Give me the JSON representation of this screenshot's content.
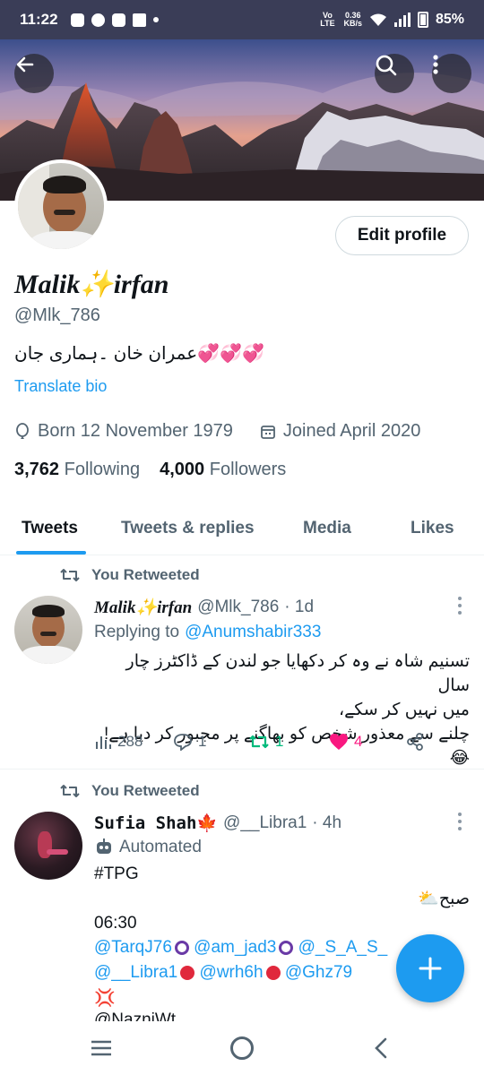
{
  "status_bar": {
    "time": "11:22",
    "network_label": "Vo LTE",
    "speed_value": "0.36",
    "speed_unit": "KB/s",
    "battery": "85%"
  },
  "profile": {
    "display_name": "Malik✨irfan",
    "handle": "@Mlk_786",
    "bio": "عمران خان ۔ہماری جان💞💞💞",
    "translate_label": "Translate bio",
    "born": "Born 12 November 1979",
    "joined": "Joined April 2020",
    "following_count": "3,762",
    "following_label": "Following",
    "followers_count": "4,000",
    "followers_label": "Followers",
    "edit_label": "Edit profile"
  },
  "tabs": [
    {
      "label": "Tweets",
      "active": true
    },
    {
      "label": "Tweets & replies",
      "active": false
    },
    {
      "label": "Media",
      "active": false
    },
    {
      "label": "Likes",
      "active": false
    }
  ],
  "tweets": [
    {
      "retweet_label": "You Retweeted",
      "author_name": "Malik✨irfan",
      "author_handle": "@Mlk_786",
      "time": "· 1d",
      "replying_prefix": "Replying to",
      "replying_to": "@Anumshabir333",
      "text_lines": [
        "تسنیم شاہ نے وہ کر دکھایا جو لندن کے ڈاکٹرز چار سال",
        "میں نہیں کر سکے،",
        "چلنے سے معذور شخص کو بھاگنے پر مجبور کر دیا ہے!😂"
      ],
      "views": "288",
      "replies": "1",
      "retweets": "1",
      "likes": "4"
    },
    {
      "retweet_label": "You Retweeted",
      "author_name": "Sufia Shah🍁",
      "author_handle": "@__Libra1",
      "time": "· 4h",
      "automated_label": "Automated",
      "hashtag": "#TPG",
      "greeting": "صبح⛅",
      "clock": "06:30",
      "mentions_line1": [
        "@TarqJ76",
        "@am_jad3",
        "@_S_A_S_"
      ],
      "mentions_line2": [
        "@__Libra1",
        "@wrh6h",
        "@Ghz79"
      ],
      "mentions_line3": "💢",
      "mentions_line4": "@NazniWt"
    }
  ],
  "colors": {
    "accent": "#1d9bf0",
    "retweet_green": "#00ba7c",
    "like_pink": "#f91880",
    "muted": "#536471"
  }
}
